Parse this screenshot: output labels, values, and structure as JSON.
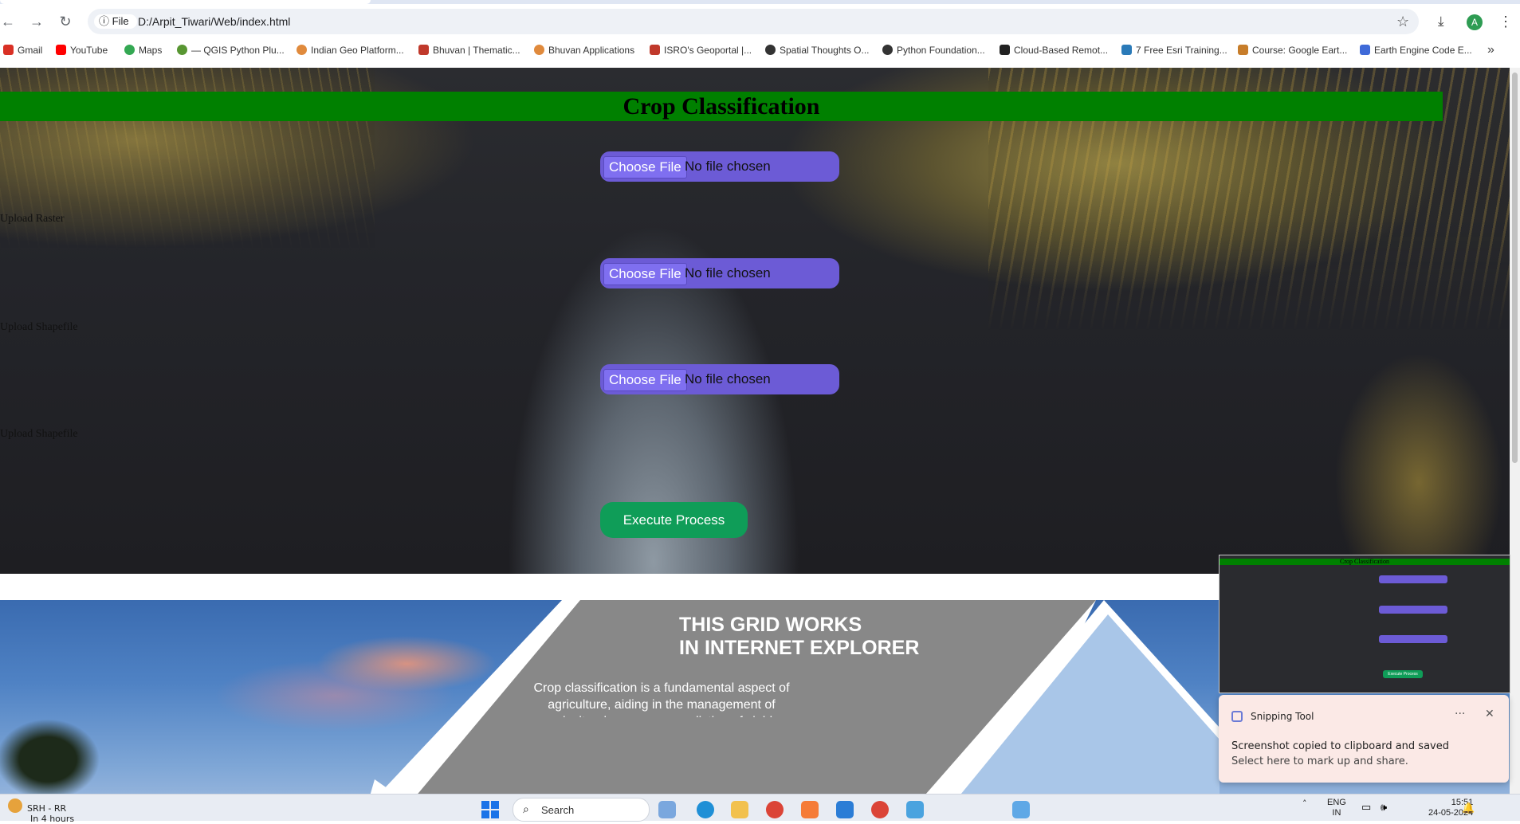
{
  "browser": {
    "tab_strip": "",
    "info_label": "File",
    "url": "D:/Arpit_Tiwari/Web/index.html",
    "avatar_letter": "A",
    "bookmarks": [
      {
        "label": "Gmail",
        "color": "#d93025"
      },
      {
        "label": "YouTube",
        "color": "#ff0000"
      },
      {
        "label": "Maps",
        "color": "#34a853"
      },
      {
        "label": "— QGIS Python Plu...",
        "color": "#589632"
      },
      {
        "label": "Indian Geo Platform...",
        "color": "#e08a3c"
      },
      {
        "label": "Bhuvan | Thematic...",
        "color": "#c0392b"
      },
      {
        "label": "Bhuvan Applications",
        "color": "#e08a3c"
      },
      {
        "label": "ISRO's Geoportal |...",
        "color": "#c0392b"
      },
      {
        "label": "Spatial Thoughts O...",
        "color": "#333333"
      },
      {
        "label": "Python Foundation...",
        "color": "#333333"
      },
      {
        "label": "Cloud-Based Remot...",
        "color": "#222222"
      },
      {
        "label": "7 Free Esri Training...",
        "color": "#2a7ab8"
      },
      {
        "label": "Course: Google Eart...",
        "color": "#c77d2a"
      },
      {
        "label": "Earth Engine Code E...",
        "color": "#3f6ad8"
      }
    ]
  },
  "page": {
    "title": "Crop Classification",
    "side_labels": [
      "Upload Raster",
      "Upload Shapefile",
      "Upload Shapefile"
    ],
    "file_inputs": [
      {
        "button": "Choose File",
        "status": "No file chosen"
      },
      {
        "button": "Choose File",
        "status": "No file chosen"
      },
      {
        "button": "Choose File",
        "status": "No file chosen"
      }
    ],
    "execute_button": "Execute Process",
    "grid_title_line1": "THIS GRID WORKS",
    "grid_title_line2": "IN INTERNET EXPLORER",
    "grid_text": "Crop classification is a fundamental aspect of agriculture, aiding in the management of agricultural resources, prediction of yields"
  },
  "snipping_tool": {
    "app_name": "Snipping Tool",
    "menu": "···",
    "close": "✕",
    "message": "Screenshot copied to clipboard and saved",
    "sub_message": "Select here to mark up and share.",
    "preview_title": "Crop Classification",
    "preview_exec": "Execute Process"
  },
  "taskbar": {
    "weather_line1": "SRH - RR",
    "weather_line2": "In 4 hours",
    "search_label": "Search",
    "lang_line1": "ENG",
    "lang_line2": "IN",
    "time": "15:51",
    "date": "24-05-2024"
  },
  "colors": {
    "title_bar": "#008000",
    "file_input": "#6c5bd6",
    "execute": "#0f9d58",
    "hex_fill": "#888888"
  }
}
